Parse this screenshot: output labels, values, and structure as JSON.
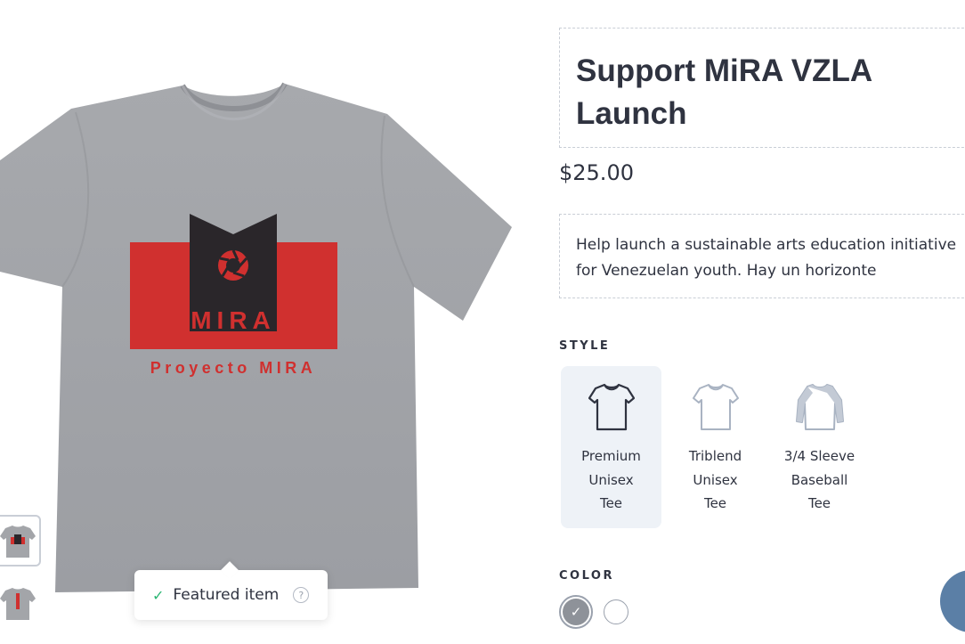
{
  "product": {
    "title": "Support MiRA VZLA Launch",
    "price": "$25.00",
    "description": "Help launch a sustainable arts education initiative for Venezuelan youth. Hay un horizonte",
    "print": {
      "logo_text": "MIRA",
      "tagline": "Proyecto MIRA"
    }
  },
  "featured": {
    "label": "Featured item",
    "help": "?"
  },
  "style_section": {
    "label": "STYLE",
    "options": [
      {
        "name": "Premium\nUnisex\nTee",
        "icon": "tshirt-icon",
        "selected": true
      },
      {
        "name": "Triblend\nUnisex\nTee",
        "icon": "tshirt-outline-icon",
        "selected": false
      },
      {
        "name": "3/4 Sleeve\nBaseball\nTee",
        "icon": "raglan-icon",
        "selected": false
      }
    ]
  },
  "color_section": {
    "label": "COLOR",
    "swatches": [
      {
        "color": "#8e9299",
        "selected": true
      },
      {
        "color": "#ffffff",
        "selected": false
      }
    ]
  },
  "thumbnails": [
    {
      "view": "front",
      "active": true
    },
    {
      "view": "back",
      "active": false
    }
  ],
  "colors": {
    "shirt_gray": "#a3a5a9",
    "print_red": "#d0302f",
    "print_black": "#2a262a",
    "selected_bg": "#eef2f7",
    "chat": "#5b7fa6"
  }
}
